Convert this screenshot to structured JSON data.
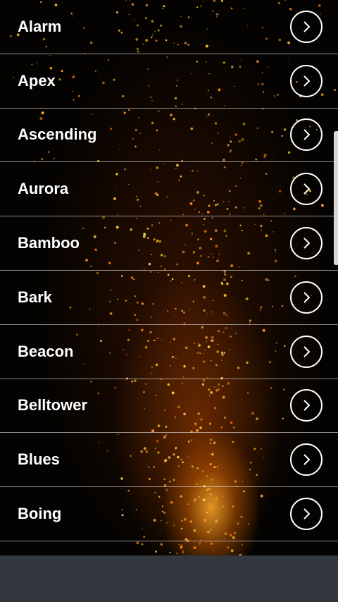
{
  "ringtones": [
    {
      "label": "Alarm"
    },
    {
      "label": "Apex"
    },
    {
      "label": "Ascending"
    },
    {
      "label": "Aurora"
    },
    {
      "label": "Bamboo"
    },
    {
      "label": "Bark"
    },
    {
      "label": "Beacon"
    },
    {
      "label": "Belltower"
    },
    {
      "label": "Blues"
    },
    {
      "label": "Boing"
    }
  ],
  "icons": {
    "row_button": "chevron-right-icon"
  },
  "colors": {
    "text": "#ffffff",
    "divider": "#ffffff",
    "bottom_bar": "#33383e",
    "scroll_thumb": "#d8d8d8"
  }
}
